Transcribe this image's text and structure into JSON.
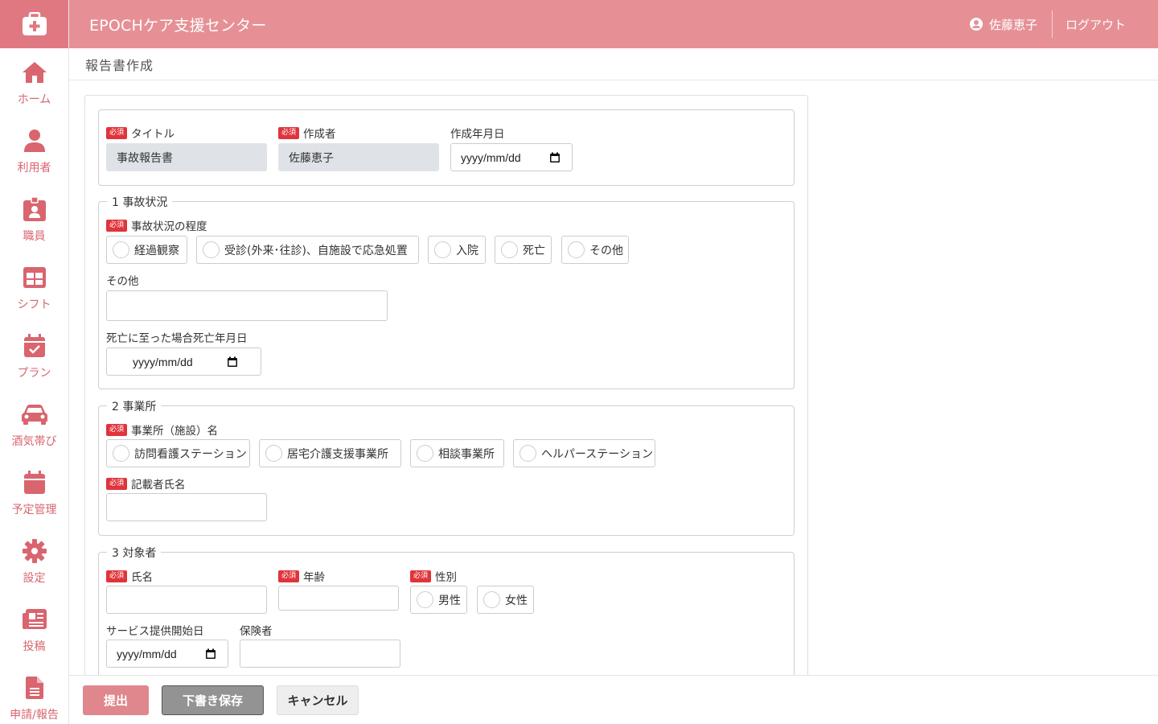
{
  "app": {
    "title": "EPOCHケア支援センター"
  },
  "header": {
    "user_name": "佐藤恵子",
    "logout_label": "ログアウト"
  },
  "sidebar": {
    "items": [
      {
        "label": "ホーム",
        "icon": "home-icon"
      },
      {
        "label": "利用者",
        "icon": "user-icon"
      },
      {
        "label": "職員",
        "icon": "id-badge-icon"
      },
      {
        "label": "シフト",
        "icon": "table-icon"
      },
      {
        "label": "プラン",
        "icon": "calendar-check-icon"
      },
      {
        "label": "酒気帯び",
        "icon": "car-icon"
      },
      {
        "label": "予定管理",
        "icon": "calendar-icon"
      },
      {
        "label": "設定",
        "icon": "gear-icon"
      },
      {
        "label": "投稿",
        "icon": "newspaper-icon"
      },
      {
        "label": "申請/報告",
        "icon": "document-icon"
      }
    ]
  },
  "page": {
    "title": "報告書作成"
  },
  "required_badge": "必須",
  "date_placeholder": "yyyy/mm/dd",
  "basic": {
    "title_label": "タイトル",
    "title_value": "事故報告書",
    "author_label": "作成者",
    "author_value": "佐藤恵子",
    "created_label": "作成年月日"
  },
  "section1": {
    "legend": "1 事故状況",
    "severity_label": "事故状況の程度",
    "options": [
      "経過観察",
      "受診(外来･往診)、自施設で応急処置",
      "入院",
      "死亡",
      "その他"
    ],
    "other_label": "その他",
    "death_date_label": "死亡に至った場合死亡年月日"
  },
  "section2": {
    "legend": "2 事業所",
    "facility_label": "事業所（施設）名",
    "options": [
      "訪問看護ステーション",
      "居宅介護支援事業所",
      "相談事業所",
      "ヘルパーステーション"
    ],
    "writer_label": "記載者氏名"
  },
  "section3": {
    "legend": "3 対象者",
    "name_label": "氏名",
    "age_label": "年齢",
    "gender_label": "性別",
    "gender_options": [
      "男性",
      "女性"
    ],
    "service_start_label": "サービス提供開始日",
    "insurer_label": "保険者"
  },
  "footer": {
    "submit": "提出",
    "draft": "下書き保存",
    "cancel": "キャンセル"
  },
  "colors": {
    "accent": "#e07881",
    "header": "#e69096",
    "required": "#e0343b",
    "submit": "#e0868d",
    "draft": "#939393"
  }
}
